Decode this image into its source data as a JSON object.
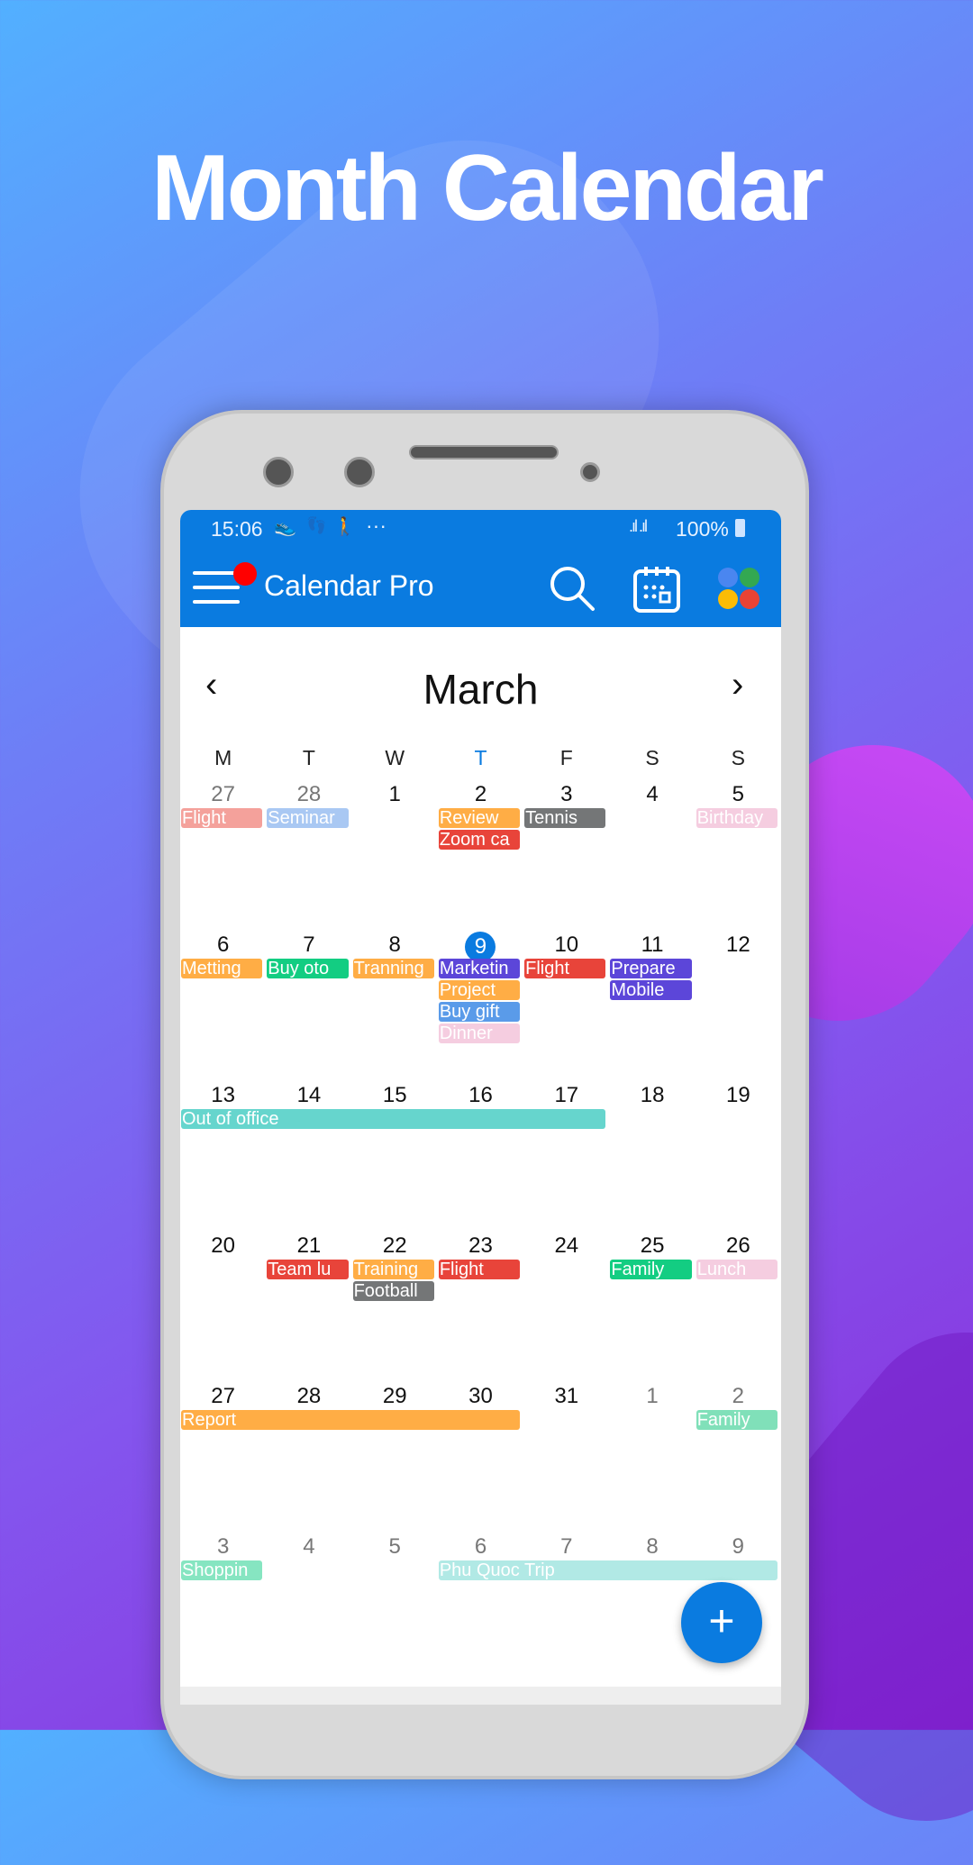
{
  "headline": "Month Calendar",
  "status_bar": {
    "time": "15:06",
    "activity_icons": [
      "shoe-icon",
      "footsteps-icon",
      "walking-icon",
      "more-dots-icon"
    ],
    "battery": "100%"
  },
  "app_bar": {
    "title": "Calendar Pro",
    "has_notification_badge": true,
    "notification_color": "#ff0000"
  },
  "calendar": {
    "month": "March",
    "prev_label": "‹",
    "next_label": "›",
    "weekdays": [
      "M",
      "T",
      "W",
      "T",
      "F",
      "S",
      "S"
    ],
    "today_weekday_index": 3,
    "weeks": [
      {
        "days": [
          "27",
          "28",
          "1",
          "2",
          "3",
          "4",
          "5"
        ],
        "muted": [
          true,
          true,
          false,
          false,
          false,
          false,
          false
        ]
      },
      {
        "days": [
          "6",
          "7",
          "8",
          "9",
          "10",
          "11",
          "12"
        ],
        "muted": [
          false,
          false,
          false,
          false,
          false,
          false,
          false
        ]
      },
      {
        "days": [
          "13",
          "14",
          "15",
          "16",
          "17",
          "18",
          "19"
        ],
        "muted": [
          false,
          false,
          false,
          false,
          false,
          false,
          false
        ]
      },
      {
        "days": [
          "20",
          "21",
          "22",
          "23",
          "24",
          "25",
          "26"
        ],
        "muted": [
          false,
          false,
          false,
          false,
          false,
          false,
          false
        ]
      },
      {
        "days": [
          "27",
          "28",
          "29",
          "30",
          "31",
          "1",
          "2"
        ],
        "muted": [
          false,
          false,
          false,
          false,
          false,
          true,
          true
        ]
      },
      {
        "days": [
          "3",
          "4",
          "5",
          "6",
          "7",
          "8",
          "9"
        ],
        "muted": [
          true,
          true,
          true,
          true,
          true,
          true,
          true
        ]
      }
    ],
    "today": {
      "week": 1,
      "day": 3
    },
    "events": [
      {
        "title": "Flight",
        "week": 0,
        "day": 0,
        "span": 1,
        "lane": 0,
        "color": "#f4a19b"
      },
      {
        "title": "Seminar",
        "week": 0,
        "day": 1,
        "span": 1,
        "lane": 0,
        "color": "#a9c8f3"
      },
      {
        "title": "Review",
        "week": 0,
        "day": 3,
        "span": 1,
        "lane": 0,
        "color": "#ffad45"
      },
      {
        "title": "Zoom ca",
        "week": 0,
        "day": 3,
        "span": 1,
        "lane": 1,
        "color": "#e8443a"
      },
      {
        "title": "Tennis",
        "week": 0,
        "day": 4,
        "span": 1,
        "lane": 0,
        "color": "#747677"
      },
      {
        "title": "Birthday",
        "week": 0,
        "day": 6,
        "span": 1,
        "lane": 0,
        "color": "#f5cde0"
      },
      {
        "title": "Metting",
        "week": 1,
        "day": 0,
        "span": 1,
        "lane": 0,
        "color": "#ffad45"
      },
      {
        "title": "Buy oto",
        "week": 1,
        "day": 1,
        "span": 1,
        "lane": 0,
        "color": "#13cd82"
      },
      {
        "title": "Tranning",
        "week": 1,
        "day": 2,
        "span": 1,
        "lane": 0,
        "color": "#ffad45"
      },
      {
        "title": "Marketin",
        "week": 1,
        "day": 3,
        "span": 1,
        "lane": 0,
        "color": "#5c46d9"
      },
      {
        "title": "Project",
        "week": 1,
        "day": 3,
        "span": 1,
        "lane": 1,
        "color": "#ffad45"
      },
      {
        "title": "Buy gift",
        "week": 1,
        "day": 3,
        "span": 1,
        "lane": 2,
        "color": "#5a9be9"
      },
      {
        "title": "Dinner",
        "week": 1,
        "day": 3,
        "span": 1,
        "lane": 3,
        "color": "#f5cde0"
      },
      {
        "title": "Flight",
        "week": 1,
        "day": 4,
        "span": 1,
        "lane": 0,
        "color": "#e8443a"
      },
      {
        "title": "Prepare",
        "week": 1,
        "day": 5,
        "span": 1,
        "lane": 0,
        "color": "#5c46d9"
      },
      {
        "title": "Mobile",
        "week": 1,
        "day": 5,
        "span": 1,
        "lane": 1,
        "color": "#5c46d9"
      },
      {
        "title": "Out of office",
        "week": 2,
        "day": 0,
        "span": 5,
        "lane": 0,
        "color": "#66d5cd"
      },
      {
        "title": "Team lu",
        "week": 3,
        "day": 1,
        "span": 1,
        "lane": 0,
        "color": "#e8443a"
      },
      {
        "title": "Training",
        "week": 3,
        "day": 2,
        "span": 1,
        "lane": 0,
        "color": "#ffad45"
      },
      {
        "title": "Football",
        "week": 3,
        "day": 2,
        "span": 1,
        "lane": 1,
        "color": "#747677"
      },
      {
        "title": "Flight",
        "week": 3,
        "day": 3,
        "span": 1,
        "lane": 0,
        "color": "#e8443a"
      },
      {
        "title": "Family",
        "week": 3,
        "day": 5,
        "span": 1,
        "lane": 0,
        "color": "#13cd82"
      },
      {
        "title": "Lunch",
        "week": 3,
        "day": 6,
        "span": 1,
        "lane": 0,
        "color": "#f5cde0"
      },
      {
        "title": "Report",
        "week": 4,
        "day": 0,
        "span": 4,
        "lane": 0,
        "color": "#ffad45"
      },
      {
        "title": "Family",
        "week": 4,
        "day": 6,
        "span": 1,
        "lane": 0,
        "color": "#80e0b9"
      },
      {
        "title": "Shoppin",
        "week": 5,
        "day": 0,
        "span": 1,
        "lane": 0,
        "color": "#86e5c1"
      },
      {
        "title": "Phu Quoc Trip",
        "week": 5,
        "day": 3,
        "span": 4,
        "lane": 0,
        "color": "#b1e9e5"
      }
    ]
  },
  "fab": {
    "label": "+"
  },
  "colors": {
    "primary": "#0a7be0",
    "today": "#0a7be0"
  }
}
